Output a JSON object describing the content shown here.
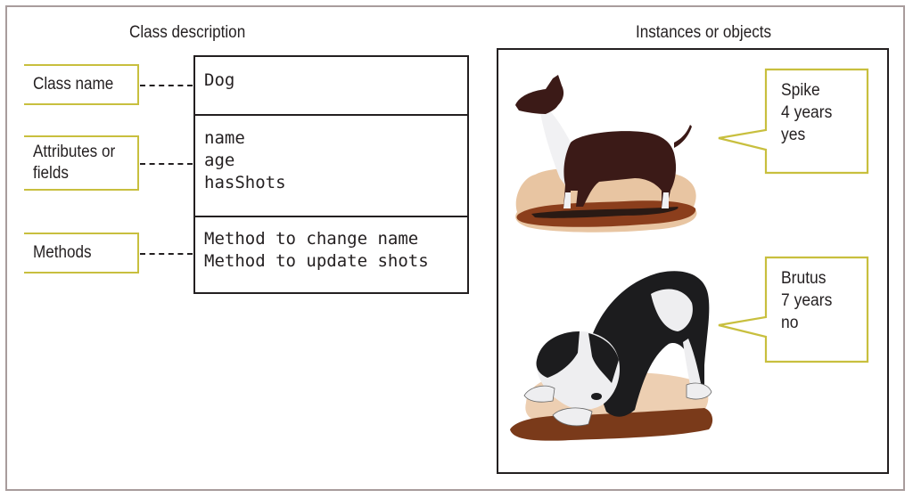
{
  "class_description": {
    "heading": "Class description",
    "labels": {
      "class_name": "Class name",
      "attributes": "Attributes or\nfields",
      "methods": "Methods"
    },
    "uml_class": {
      "name": "Dog",
      "attributes": [
        "name",
        "age",
        "hasShots"
      ],
      "methods": [
        "Method to change name",
        "Method to update shots"
      ]
    }
  },
  "instances": {
    "heading": "Instances or objects",
    "objects": [
      {
        "illustration": "bull-terrier-dog-illustration",
        "lines": [
          "Spike",
          "4 years",
          "yes"
        ]
      },
      {
        "illustration": "puppy-dog-illustration",
        "lines": [
          "Brutus",
          "7 years",
          "no"
        ]
      }
    ]
  },
  "colors": {
    "label_border": "#c8bf3e",
    "frame_border": "#a89c9c",
    "line": "#231f20"
  }
}
